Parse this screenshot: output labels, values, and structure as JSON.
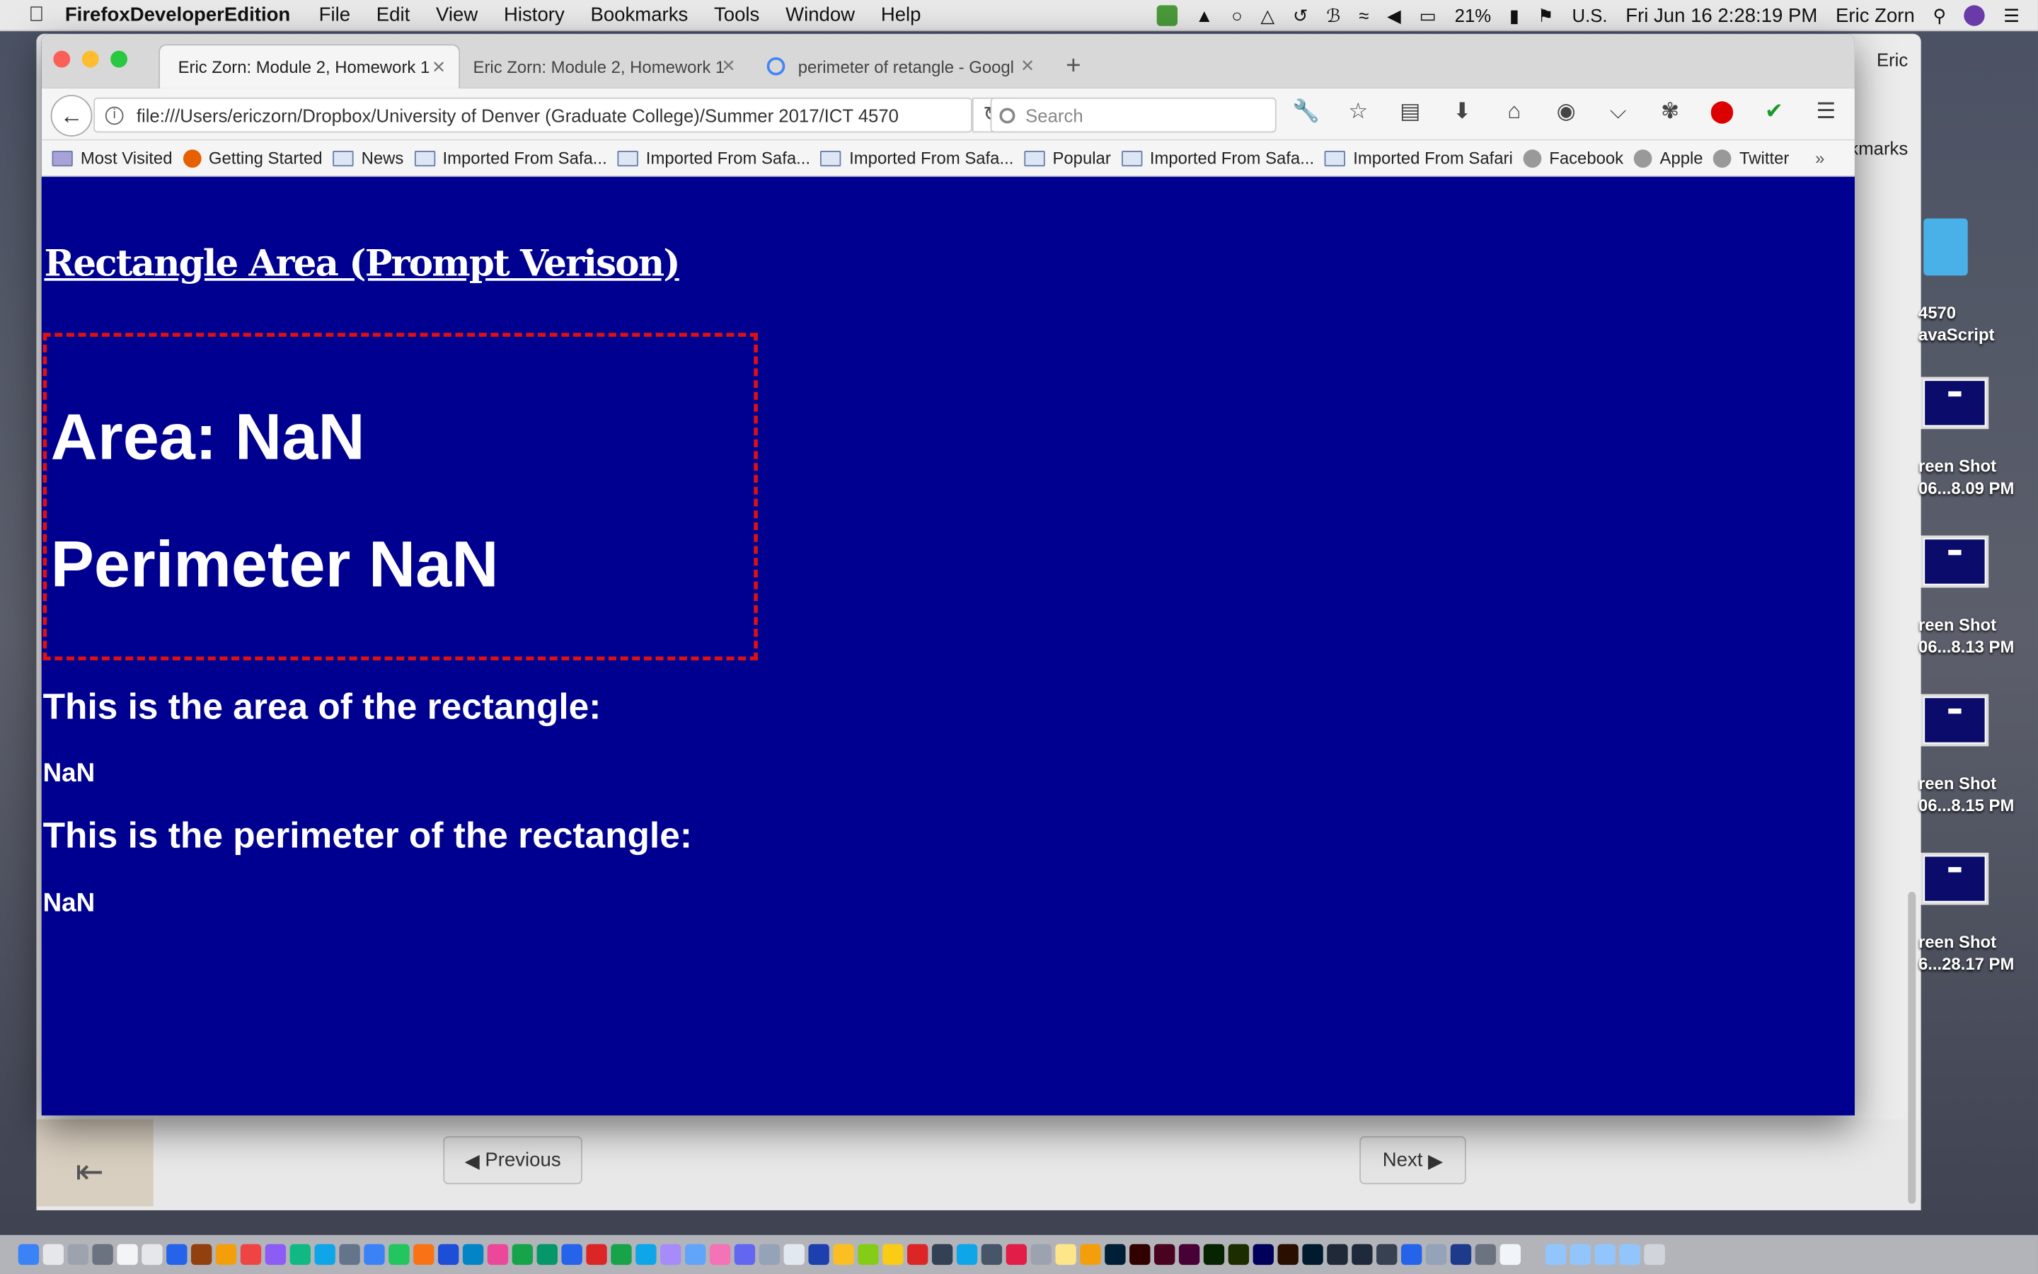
{
  "menubar": {
    "app": "FirefoxDeveloperEdition",
    "items": [
      "File",
      "Edit",
      "View",
      "History",
      "Bookmarks",
      "Tools",
      "Window",
      "Help"
    ],
    "battery": "21%",
    "input_source": "U.S.",
    "datetime": "Fri Jun 16  2:28:19 PM",
    "user": "Eric Zorn"
  },
  "background_window": {
    "user_label": "Eric",
    "bookmarks_fragment": "kmarks",
    "previous_label": "Previous",
    "next_label": "Next"
  },
  "desktop": {
    "icons": [
      {
        "line1": "4570",
        "line2": "avaScript"
      },
      {
        "line1": "reen Shot",
        "line2": "06...8.09 PM"
      },
      {
        "line1": "reen Shot",
        "line2": "06...8.13 PM"
      },
      {
        "line1": "reen Shot",
        "line2": "06...8.15 PM"
      },
      {
        "line1": "reen Shot",
        "line2": "6...28.17 PM"
      }
    ]
  },
  "browser": {
    "tabs": [
      {
        "title": "Eric Zorn: Module 2, Homework 1",
        "active": true
      },
      {
        "title": "Eric Zorn: Module 2, Homework 1",
        "active": false
      },
      {
        "title": "perimeter of retangle - Googl",
        "active": false
      }
    ],
    "url": "file:///Users/ericzorn/Dropbox/University of Denver (Graduate College)/Summer 2017/ICT 4570",
    "search_placeholder": "Search",
    "bookmarks": [
      "Most Visited",
      "Getting Started",
      "News",
      "Imported From Safa...",
      "Imported From Safa...",
      "Imported From Safa...",
      "Popular",
      "Imported From Safa...",
      "Imported From Safari",
      "Facebook",
      "Apple",
      "Twitter"
    ]
  },
  "page": {
    "heading": "Rectangle Area (Prompt Verison)",
    "area_display": "Area: NaN",
    "perimeter_display": "Perimeter NaN",
    "area_heading": "This is the area of the rectangle:",
    "area_value": "NaN",
    "perimeter_heading": "This is the perimeter of the rectangle:",
    "perimeter_value": "NaN"
  },
  "colors": {
    "page_bg": "#000090",
    "box_border": "#e01010",
    "text": "#ffffff"
  }
}
